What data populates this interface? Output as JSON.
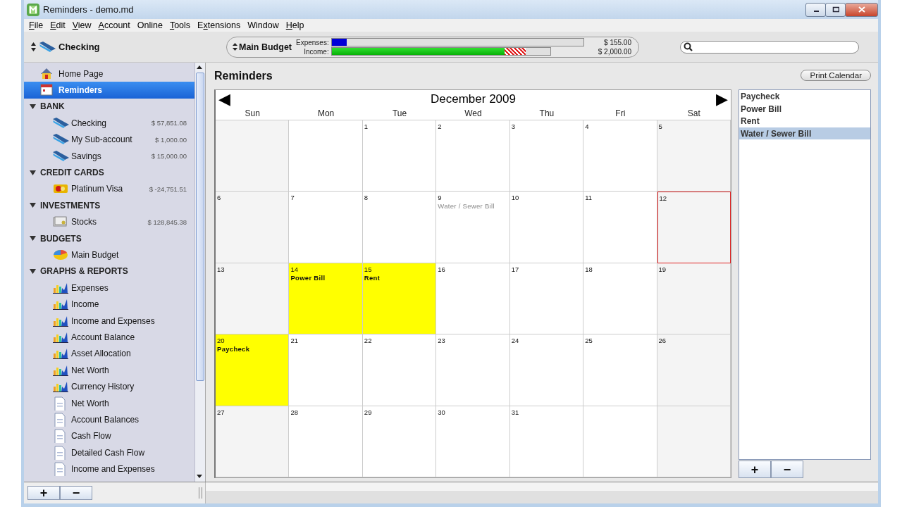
{
  "window": {
    "title": "Reminders - demo.md"
  },
  "menu": [
    {
      "label": "File",
      "kind": "key1"
    },
    {
      "label": "Edit",
      "kind": "key1"
    },
    {
      "label": "View",
      "kind": "key1"
    },
    {
      "label": "Account",
      "kind": "key1"
    },
    {
      "label": "Online",
      "kind": "plain"
    },
    {
      "label": "Tools",
      "kind": "key1"
    },
    {
      "label": "Extensions",
      "kind": "key2"
    },
    {
      "label": "Window",
      "kind": "plain"
    },
    {
      "label": "Help",
      "kind": "key1"
    }
  ],
  "account_selector": {
    "label": "Checking"
  },
  "budget": {
    "name": "Main Budget",
    "bars": [
      {
        "label": "Expenses:",
        "level": 0.06,
        "reading": "$ 155.00",
        "kind": "expense"
      },
      {
        "label": "Income:",
        "level": 0.79,
        "reading": "$ 2,000.00",
        "kind": "income"
      }
    ]
  },
  "sidebar": {
    "items": [
      {
        "label": "Home Page",
        "kind": "home",
        "selected": false
      },
      {
        "label": "Reminders",
        "kind": "reminders",
        "selected": true
      },
      {
        "label": "BANK",
        "kind": "section",
        "expanded": true,
        "children": [
          {
            "label": "Checking",
            "kind": "bank",
            "amount": "$ 57,851.08",
            "selected": false
          },
          {
            "label": "My Sub-account",
            "kind": "bank",
            "amount": "$ 1,000.00",
            "selected": false
          },
          {
            "label": "Savings",
            "kind": "bank",
            "amount": "$ 15,000.00",
            "selected": false
          }
        ]
      },
      {
        "label": "CREDIT CARDS",
        "kind": "section",
        "expanded": true,
        "children": [
          {
            "label": "Platinum Visa",
            "kind": "card",
            "amount": "$ -24,751.51",
            "selected": false
          }
        ]
      },
      {
        "label": "INVESTMENTS",
        "kind": "section",
        "expanded": true,
        "children": [
          {
            "label": "Stocks",
            "kind": "stock",
            "amount": "$ 128,845.38",
            "selected": false
          }
        ]
      },
      {
        "label": "BUDGETS",
        "kind": "section",
        "expanded": true,
        "children": [
          {
            "label": "Main Budget",
            "kind": "budget",
            "selected": false
          }
        ]
      },
      {
        "label": "GRAPHS & REPORTS",
        "kind": "section",
        "expanded": true,
        "children": [
          {
            "label": "Expenses",
            "kind": "graph",
            "selected": false
          },
          {
            "label": "Income",
            "kind": "graph",
            "selected": false
          },
          {
            "label": "Income and Expenses",
            "kind": "graph",
            "selected": false
          },
          {
            "label": "Account Balance",
            "kind": "graph",
            "selected": false
          },
          {
            "label": "Asset Allocation",
            "kind": "graph",
            "selected": false
          },
          {
            "label": "Net Worth",
            "kind": "graph",
            "selected": false
          },
          {
            "label": "Currency History",
            "kind": "graph",
            "selected": false
          },
          {
            "label": "Net Worth",
            "kind": "report",
            "selected": false
          },
          {
            "label": "Account Balances",
            "kind": "report",
            "selected": false
          },
          {
            "label": "Cash Flow",
            "kind": "report",
            "selected": false
          },
          {
            "label": "Detailed Cash Flow",
            "kind": "report",
            "selected": false
          },
          {
            "label": "Income and Expenses",
            "kind": "report",
            "selected": false
          }
        ]
      }
    ]
  },
  "page_title": "Reminders",
  "print_button": "Print Calendar",
  "calendar": {
    "month": "December 2009",
    "prev": "◀",
    "next": "▶",
    "weekdays": [
      "Sun",
      "Mon",
      "Tue",
      "Wed",
      "Thu",
      "Fri",
      "Sat"
    ],
    "weeks": [
      {
        "kind": "first",
        "days": [
          {
            "day": "1"
          },
          {
            "day": "2"
          },
          {
            "day": "3"
          },
          {
            "day": "4"
          },
          {
            "day": "5"
          }
        ]
      },
      {
        "days": [
          {
            "day": "6"
          },
          {
            "day": "7"
          },
          {
            "day": "8"
          },
          {
            "day": "9",
            "event": "Water / Sewer Bill",
            "highlighted": false
          },
          {
            "day": "10"
          },
          {
            "day": "11"
          },
          {
            "day": "12",
            "today": true
          }
        ]
      },
      {
        "days": [
          {
            "day": "13"
          },
          {
            "day": "14",
            "event": "Power Bill",
            "highlighted": true
          },
          {
            "day": "15",
            "event": "Rent",
            "highlighted": true
          },
          {
            "day": "16"
          },
          {
            "day": "17"
          },
          {
            "day": "18"
          },
          {
            "day": "19"
          }
        ]
      },
      {
        "days": [
          {
            "day": "20",
            "event": "Paycheck",
            "highlighted": true
          },
          {
            "day": "21"
          },
          {
            "day": "22"
          },
          {
            "day": "23"
          },
          {
            "day": "24"
          },
          {
            "day": "25"
          },
          {
            "day": "26"
          }
        ]
      },
      {
        "kind": "last",
        "days": [
          {
            "day": "27"
          },
          {
            "day": "28"
          },
          {
            "day": "29"
          },
          {
            "day": "30"
          },
          {
            "day": "31"
          }
        ]
      }
    ]
  },
  "reminders": [
    {
      "label": "Paycheck",
      "selected": false
    },
    {
      "label": "Power Bill",
      "selected": false
    },
    {
      "label": "Rent",
      "selected": false
    },
    {
      "label": "Water / Sewer Bill",
      "selected": true
    }
  ],
  "list_buttons": [
    "+",
    "−"
  ],
  "sidebar_buttons": [
    "+",
    "−"
  ]
}
